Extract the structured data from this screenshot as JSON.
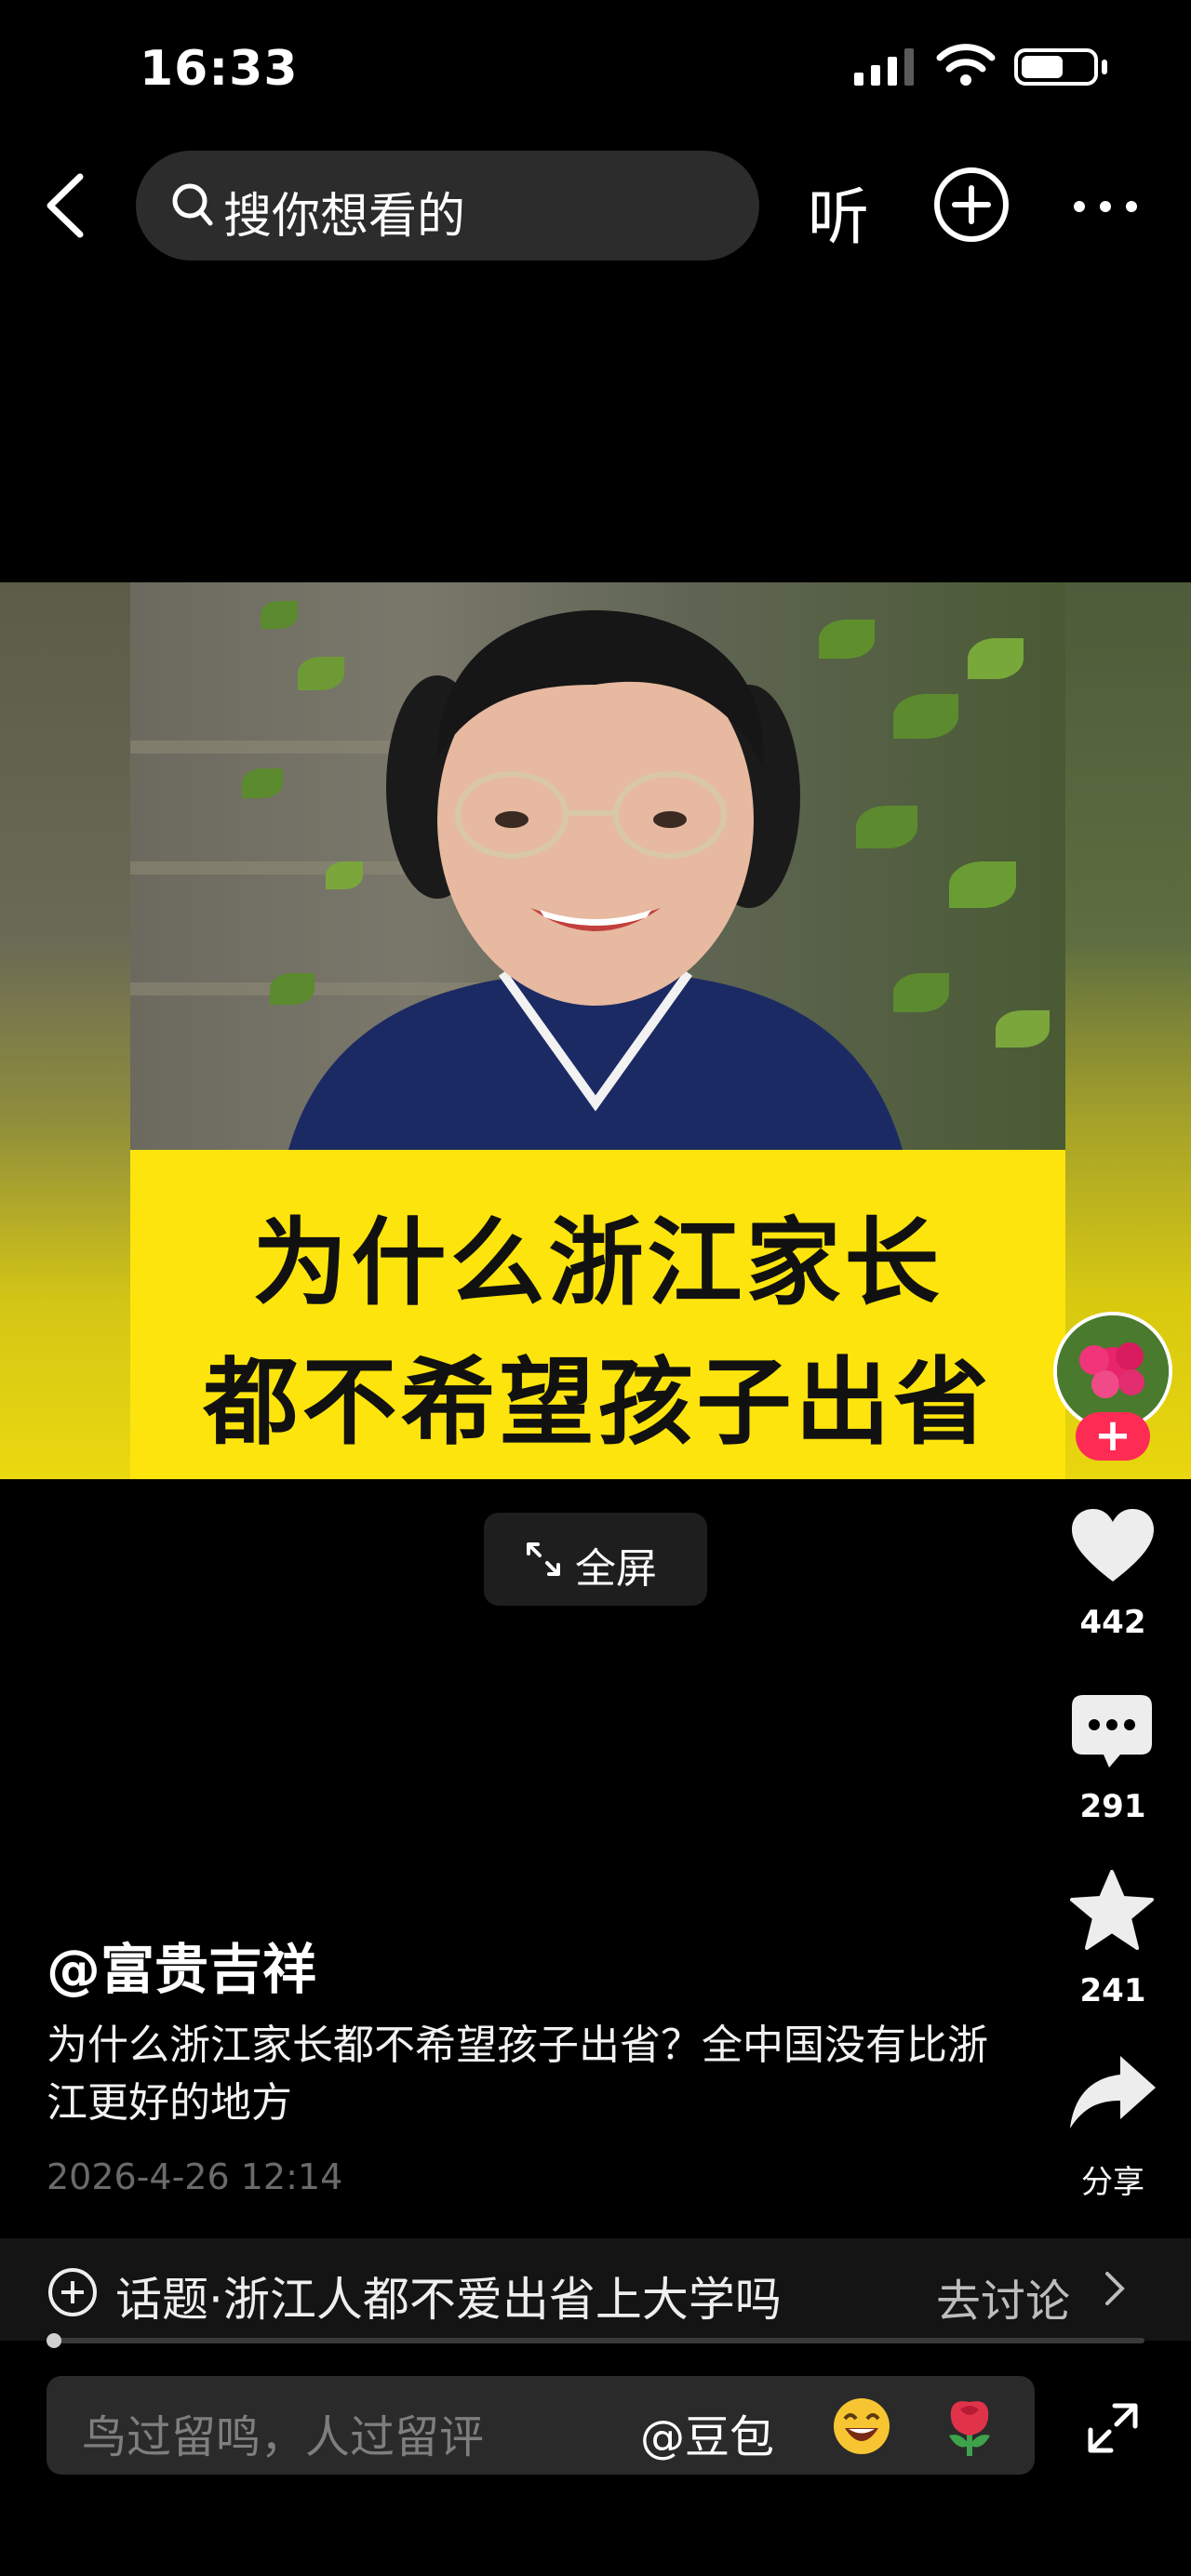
{
  "status_bar": {
    "time": "16:33"
  },
  "top_nav": {
    "search_placeholder": "搜你想看的",
    "listen_label": "听"
  },
  "video": {
    "caption_line1": "为什么浙江家长",
    "caption_line2": "都不希望孩子出省",
    "fullscreen_label": "全屏"
  },
  "rail": {
    "likes": "442",
    "comments": "291",
    "favorites": "241",
    "share_label": "分享",
    "follow_symbol": "+"
  },
  "post": {
    "author": "@富贵吉祥",
    "description": "为什么浙江家长都不希望孩子出省？全中国没有比浙江更好的地方",
    "date": "2026-4-26 12:14"
  },
  "topic": {
    "text": "话题·浙江人都不爱出省上大学吗",
    "action": "去讨论"
  },
  "comment_bar": {
    "placeholder": "鸟过留鸣，人过留评",
    "mention": "@豆包"
  },
  "colors": {
    "accent": "#fe2c55",
    "caption_bg": "#fde40c"
  }
}
